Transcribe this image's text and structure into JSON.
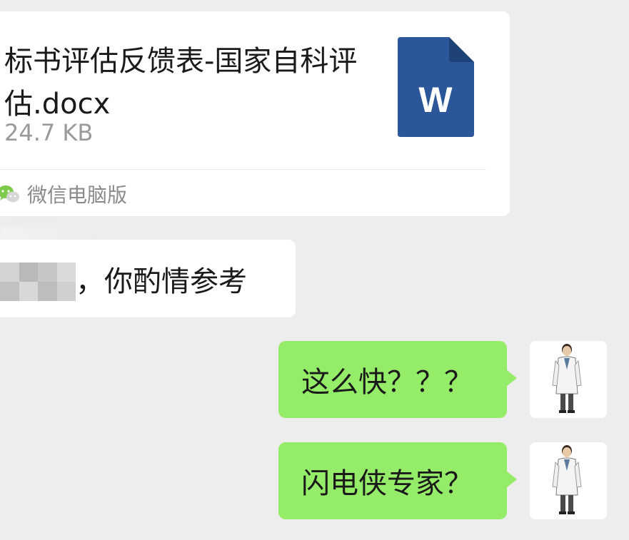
{
  "file_message": {
    "file_name": "标书评估反馈表-国家自科评估.docx",
    "file_size": "24.7 KB",
    "file_icon_letter": "W",
    "file_icon": "word-document-icon",
    "source_icon": "wechat-icon",
    "source_label": "微信电脑版"
  },
  "incoming_message": {
    "text": "，你酌情参考"
  },
  "outgoing_messages": [
    {
      "text": "这么快？？？",
      "avatar": "doctor-avatar"
    },
    {
      "text": "闪电侠专家？",
      "avatar": "doctor-avatar"
    }
  ],
  "colors": {
    "background": "#ededed",
    "incoming_bubble": "#ffffff",
    "outgoing_bubble": "#95ec69",
    "word_blue": "#2b579a",
    "secondary_text": "#9a9a9a"
  }
}
